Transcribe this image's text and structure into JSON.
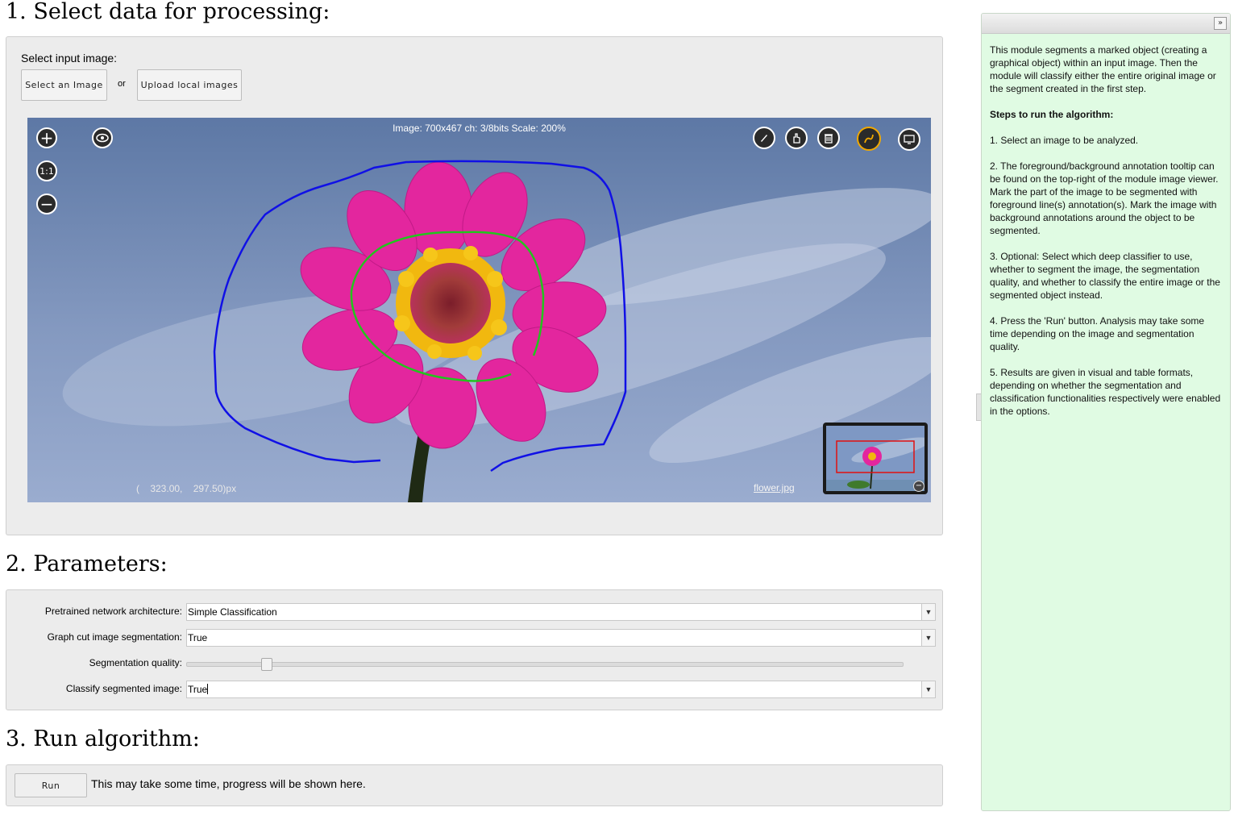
{
  "section1": {
    "title": "1. Select data for processing:",
    "select_label": "Select input image:",
    "select_button": "Select an Image",
    "or_text": "or",
    "upload_button": "Upload local images",
    "viewer": {
      "info": "Image: 700x467 ch: 3/8bits Scale: 200%",
      "coords": "(    323.00,    297.50)px",
      "filename": "flower.jpg",
      "zoom_reset": "1:1"
    }
  },
  "section2": {
    "title": "2. Parameters:",
    "params": [
      {
        "label": "Pretrained network architecture:",
        "value": "Simple Classification"
      },
      {
        "label": "Graph cut image segmentation:",
        "value": "True"
      },
      {
        "label": "Segmentation quality:",
        "slider_fraction": 0.11
      },
      {
        "label": "Classify segmented image:",
        "value": "True"
      }
    ]
  },
  "section3": {
    "title": "3. Run algorithm:",
    "run_button": "Run",
    "status": "This may take some time, progress will be shown here."
  },
  "help": {
    "collapse_icon": "double-chevron-right-icon",
    "paragraphs": [
      "This module segments a marked object (creating a graphical object) within an input image. Then the module will classify either the entire original image or the segment created in the first step.",
      "Steps to run the algorithm:",
      "1. Select an image to be analyzed.",
      "2. The foreground/background annotation tooltip can be found on the top-right of the module image viewer. Mark the part of the image to be segmented with foreground line(s) annotation(s). Mark the image with background annotations around the object to be segmented.",
      "3. Optional: Select which deep classifier to use, whether to segment the image, the segmentation quality, and whether to classify the entire image or the segmented object instead.",
      "4. Press the 'Run' button. Analysis may take some time depending on the image and segmentation quality.",
      "5. Results are given in visual and table formats, depending on whether the segmentation and classification functionalities respectively were enabled in the options."
    ]
  },
  "colors": {
    "foreground_stroke": "#22c41e",
    "background_stroke": "#1010e6",
    "help_bg": "#e0fbe3",
    "active_tool": "#f0a800"
  }
}
